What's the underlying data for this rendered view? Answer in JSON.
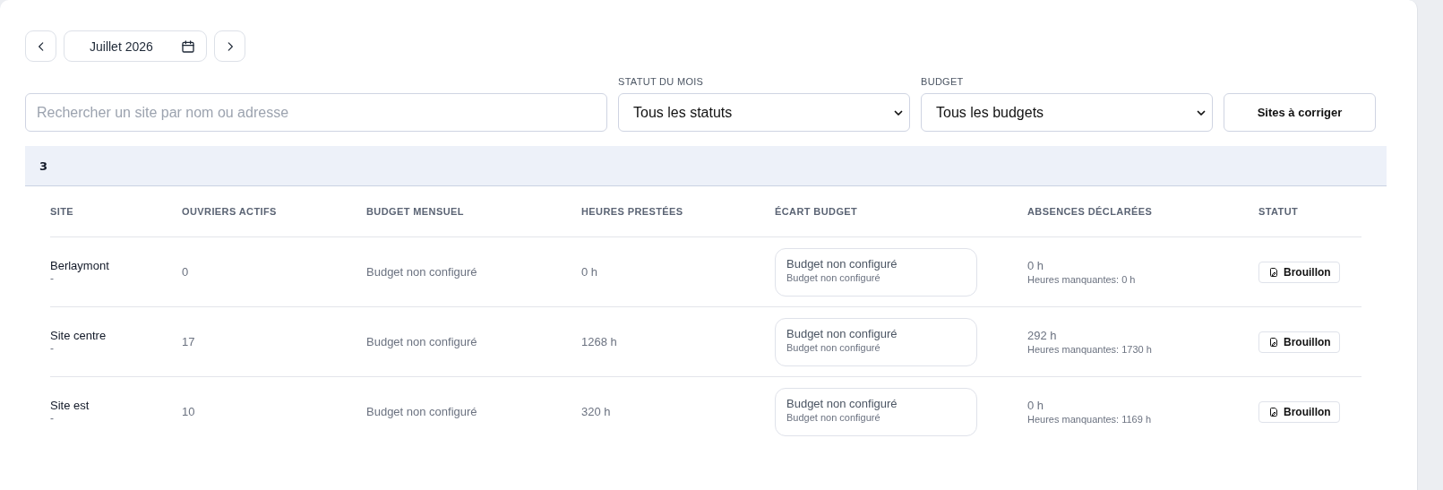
{
  "period": {
    "label": "Juillet 2026"
  },
  "filters": {
    "search": {
      "placeholder": "Rechercher un site par nom ou adresse"
    },
    "status": {
      "label": "STATUT DU MOIS",
      "value": "Tous les statuts"
    },
    "budget": {
      "label": "BUDGET",
      "value": "Tous les budgets"
    },
    "button": "Sites à corriger"
  },
  "group": {
    "count": "3"
  },
  "table": {
    "columns": [
      "SITE",
      "OUVRIERS ACTIFS",
      "BUDGET MENSUEL",
      "HEURES PRESTÉES",
      "ÉCART BUDGET",
      "ABSENCES DÉCLARÉES",
      "STATUT"
    ],
    "rows": [
      {
        "site": "Berlaymont",
        "address": "-",
        "workers": "0",
        "budget": "Budget non configuré",
        "hours": "0 h",
        "gap": {
          "title": "Budget non configuré",
          "detail": "Budget non configuré"
        },
        "absences": "0 h",
        "missing": "Heures manquantes: 0 h",
        "status": {
          "kind": "draft",
          "label": "Brouillon"
        }
      },
      {
        "site": "Site centre",
        "address": "-",
        "workers": "17",
        "budget": "Budget non configuré",
        "hours": "1268 h",
        "gap": {
          "title": "Budget non configuré",
          "detail": "Budget non configuré"
        },
        "absences": "292 h",
        "missing": "Heures manquantes: 1730 h",
        "status": {
          "kind": "draft",
          "label": "Brouillon"
        }
      },
      {
        "site": "Site est",
        "address": "-",
        "workers": "10",
        "budget": "Budget non configuré",
        "hours": "320 h",
        "gap": {
          "title": "Budget non configuré",
          "detail": "Budget non configuré"
        },
        "absences": "0 h",
        "missing": "Heures manquantes: 1169 h",
        "status": {
          "kind": "draft",
          "label": "Brouillon"
        }
      }
    ]
  }
}
